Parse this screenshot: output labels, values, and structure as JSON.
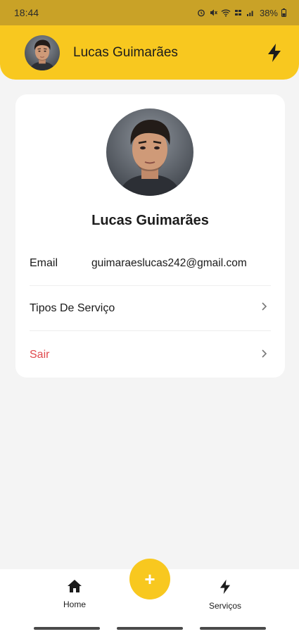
{
  "status_bar": {
    "time": "18:44",
    "battery": "38%"
  },
  "header": {
    "user_name": "Lucas Guimarães",
    "action_icon": "bolt-icon"
  },
  "profile": {
    "name": "Lucas Guimarães",
    "rows": [
      {
        "label": "Email",
        "value": "guimaraeslucas242@gmail.com"
      },
      {
        "label": "Tipos De Serviço"
      },
      {
        "label": "Sair"
      }
    ]
  },
  "bottom_nav": {
    "items": [
      {
        "label": "Home",
        "icon": "home-icon"
      },
      {
        "label": "Serviços",
        "icon": "bolt-icon"
      }
    ],
    "fab_label": "+"
  },
  "colors": {
    "accent": "#f8c81f",
    "status_bar": "#c9a227",
    "danger": "#e0494d",
    "background": "#f4f4f4"
  }
}
